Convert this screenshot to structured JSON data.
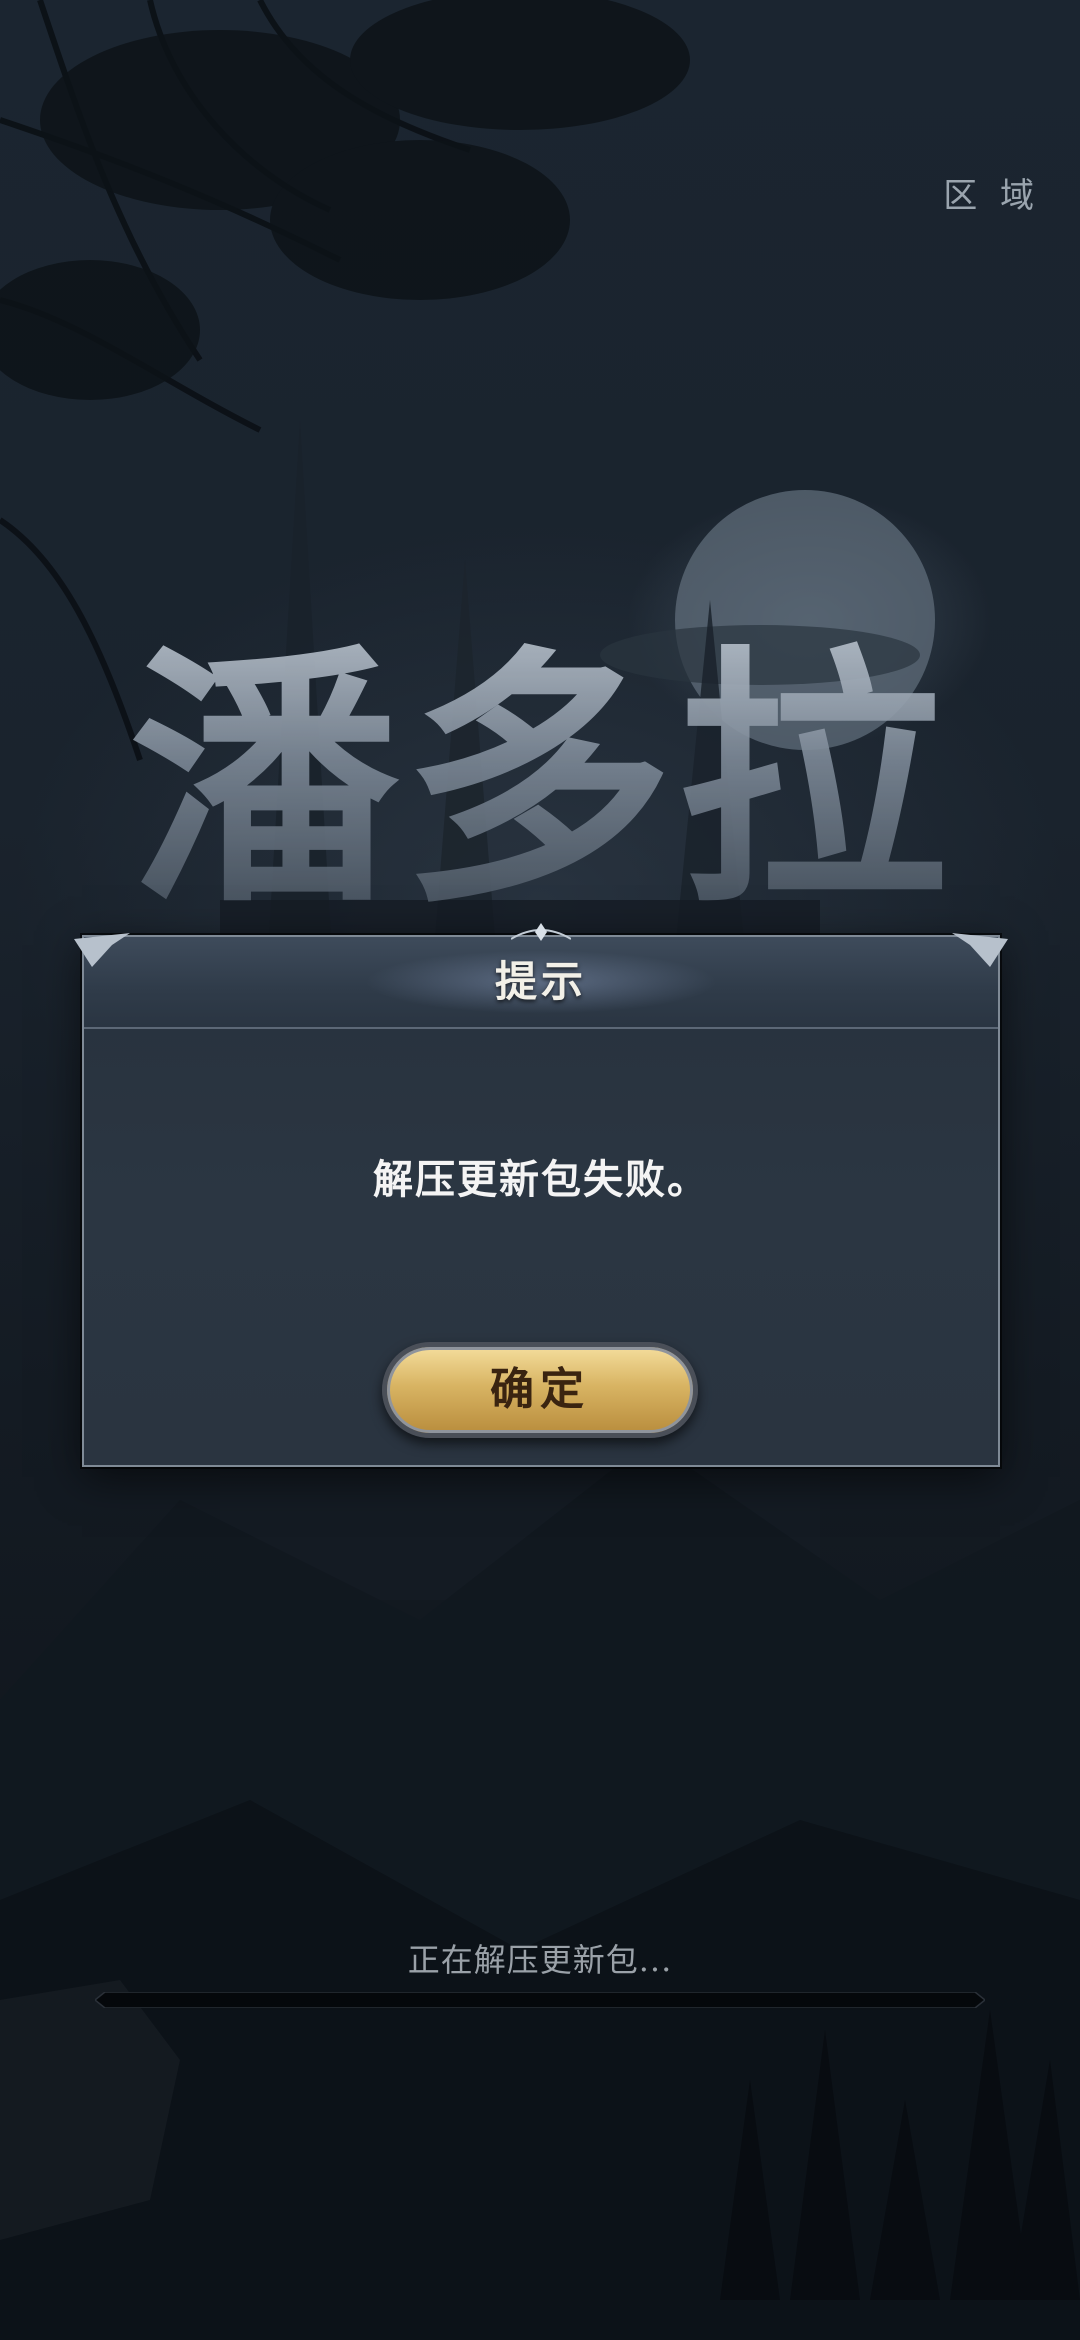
{
  "header": {
    "region_label": "区 域"
  },
  "logo": {
    "title": "潘多拉"
  },
  "dialog": {
    "title": "提示",
    "message": "解压更新包失败。",
    "confirm_label": "确定"
  },
  "loading": {
    "status_text": "正在解压更新包...",
    "progress": 0
  }
}
